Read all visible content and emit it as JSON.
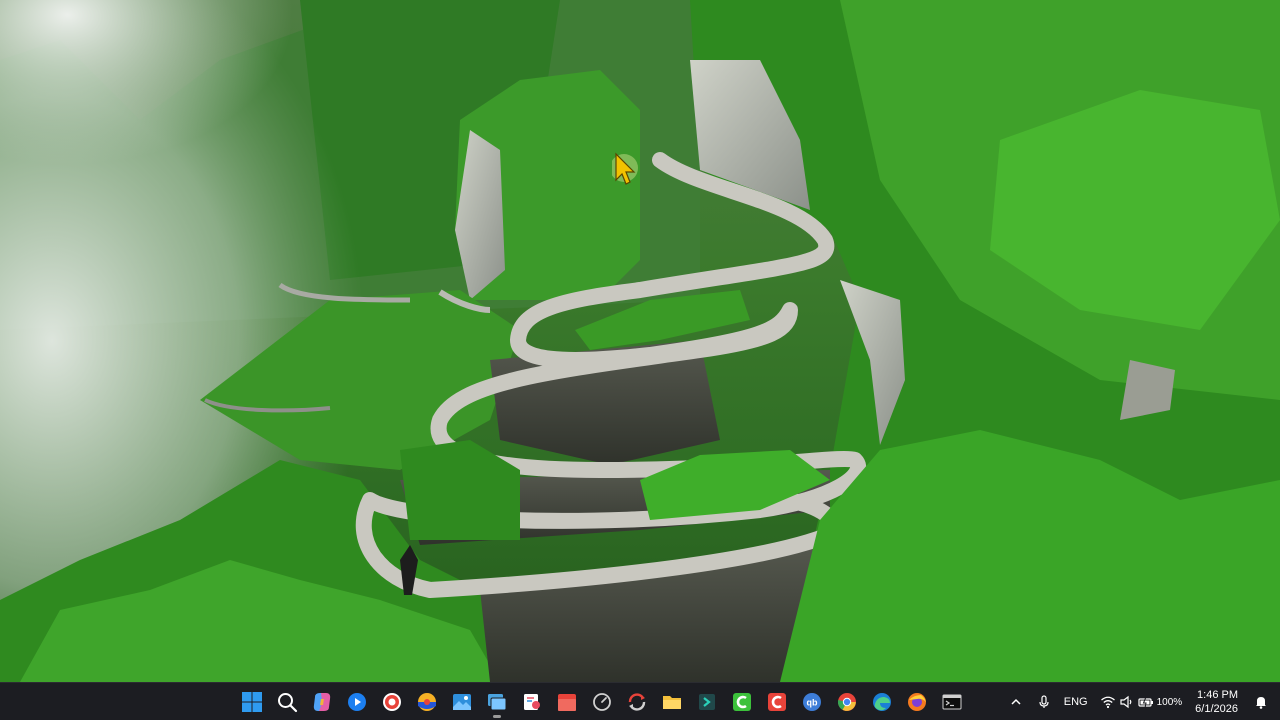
{
  "wallpaper": {
    "description_icon": "mountain-road-wallpaper"
  },
  "taskbar": {
    "apps": [
      {
        "name": "start-button",
        "icon": "windows-logo-icon",
        "accent": "#2f9bf0"
      },
      {
        "name": "search-button",
        "icon": "search-icon",
        "accent": "#ffffff"
      },
      {
        "name": "copilot-button",
        "icon": "copilot-icon",
        "accent": "#8a6cf0"
      },
      {
        "name": "media-player-button",
        "icon": "play-icon",
        "accent": "#1c7ff0"
      },
      {
        "name": "screen-recorder-button",
        "icon": "record-icon",
        "accent": "#e8433a"
      },
      {
        "name": "vpn-app-button",
        "icon": "shield-globe-icon",
        "accent": "#2556d8"
      },
      {
        "name": "photos-button",
        "icon": "photos-icon",
        "accent": "#2e8fdc"
      },
      {
        "name": "file-explorer-window-button",
        "icon": "window-stack-icon",
        "accent": "#4aa3df"
      },
      {
        "name": "snipping-tool-button",
        "icon": "snip-icon",
        "accent": "#e84a5f"
      },
      {
        "name": "calendar-app-button",
        "icon": "calendar-icon",
        "accent": "#e8433a"
      },
      {
        "name": "speedtest-button",
        "icon": "gauge-icon",
        "accent": "#d0d0d0"
      },
      {
        "name": "sync-app-button",
        "icon": "sync-icon",
        "accent": "#e8433a"
      },
      {
        "name": "file-explorer-button",
        "icon": "folder-icon",
        "accent": "#f4c03b"
      },
      {
        "name": "terminal-app-button",
        "icon": "arrow-box-icon",
        "accent": "#2aa198"
      },
      {
        "name": "camtasia-button",
        "icon": "green-c-icon",
        "accent": "#3cc13b"
      },
      {
        "name": "capcut-button",
        "icon": "red-c-icon",
        "accent": "#e8433a"
      },
      {
        "name": "qbittorrent-button",
        "icon": "qb-icon",
        "accent": "#3d7dd8"
      },
      {
        "name": "chrome-button",
        "icon": "chrome-icon",
        "accent": "#e8433a"
      },
      {
        "name": "edge-button",
        "icon": "edge-icon",
        "accent": "#2fb5e8"
      },
      {
        "name": "firefox-button",
        "icon": "firefox-icon",
        "accent": "#f57a1f"
      },
      {
        "name": "command-prompt-button",
        "icon": "terminal-icon",
        "accent": "#d0d0d0"
      }
    ],
    "tray": {
      "language": "ENG",
      "battery_percent": "100%",
      "time": "1:46 PM",
      "date": "6/1/2026"
    }
  }
}
